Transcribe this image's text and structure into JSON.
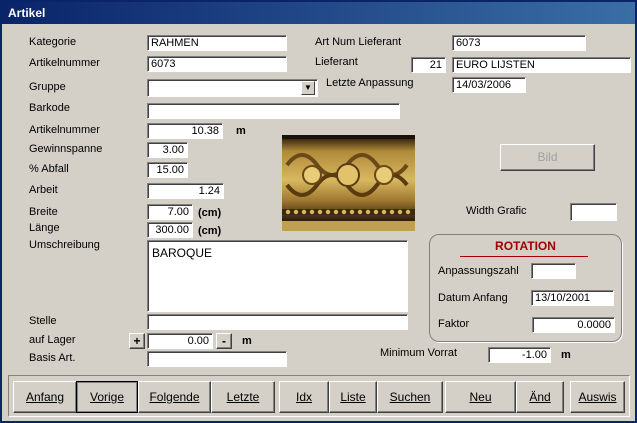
{
  "window": {
    "title": "Artikel"
  },
  "form": {
    "kategorie": {
      "label": "Kategorie",
      "value": "RAHMEN"
    },
    "artikelnummer": {
      "label": "Artikelnummer",
      "value": "6073"
    },
    "gruppe": {
      "label": "Gruppe",
      "value": ""
    },
    "barkode": {
      "label": "Barkode",
      "value": ""
    },
    "artikelnummer2": {
      "label": "Artikelnummer",
      "value": "10.38",
      "unit": "m"
    },
    "gewinnspanne": {
      "label": "Gewinnspanne",
      "value": "3.00"
    },
    "abfall": {
      "label": "% Abfall",
      "value": "15.00"
    },
    "arbeit": {
      "label": "Arbeit",
      "value": "1.24"
    },
    "breite": {
      "label": "Breite",
      "value": "7.00",
      "unit": "(cm)"
    },
    "laenge": {
      "label": "Länge",
      "value": "300.00",
      "unit": "(cm)"
    },
    "umschreibung": {
      "label": "Umschreibung",
      "value": "BAROQUE"
    },
    "stelle": {
      "label": "Stelle",
      "value": ""
    },
    "auf_lager": {
      "label": "auf Lager",
      "value": "0.00",
      "plus": "+",
      "minus": "-",
      "unit": "m"
    },
    "basis_art": {
      "label": "Basis Art.",
      "value": ""
    },
    "art_num_lieferant": {
      "label": "Art Num Lieferant",
      "value": "6073"
    },
    "lieferant": {
      "label": "Lieferant",
      "code": "21",
      "name": "EURO LIJSTEN"
    },
    "letzte_anpassung": {
      "label": "Letzte Anpassung",
      "value": "14/03/2006"
    },
    "bild_button": "Bild",
    "width_grafic": {
      "label": "Width Grafic",
      "value": ""
    },
    "minimum_vorrat": {
      "label": "Minimum Vorrat",
      "value": "-1.00",
      "unit": "m"
    }
  },
  "rotation": {
    "title": "ROTATION",
    "anpassungszahl": {
      "label": "Anpassungszahl",
      "value": ""
    },
    "datum_anfang": {
      "label": "Datum Anfang",
      "value": "13/10/2001"
    },
    "faktor": {
      "label": "Faktor",
      "value": "0.0000"
    }
  },
  "toolbar": {
    "buttons": [
      "Anfang",
      "Vorige",
      "Folgende",
      "Letzte",
      "Idx",
      "Liste",
      "Suchen",
      "Neu",
      "Änd",
      "Auswis"
    ]
  },
  "icons": {
    "combo": "chevron-down-icon"
  }
}
